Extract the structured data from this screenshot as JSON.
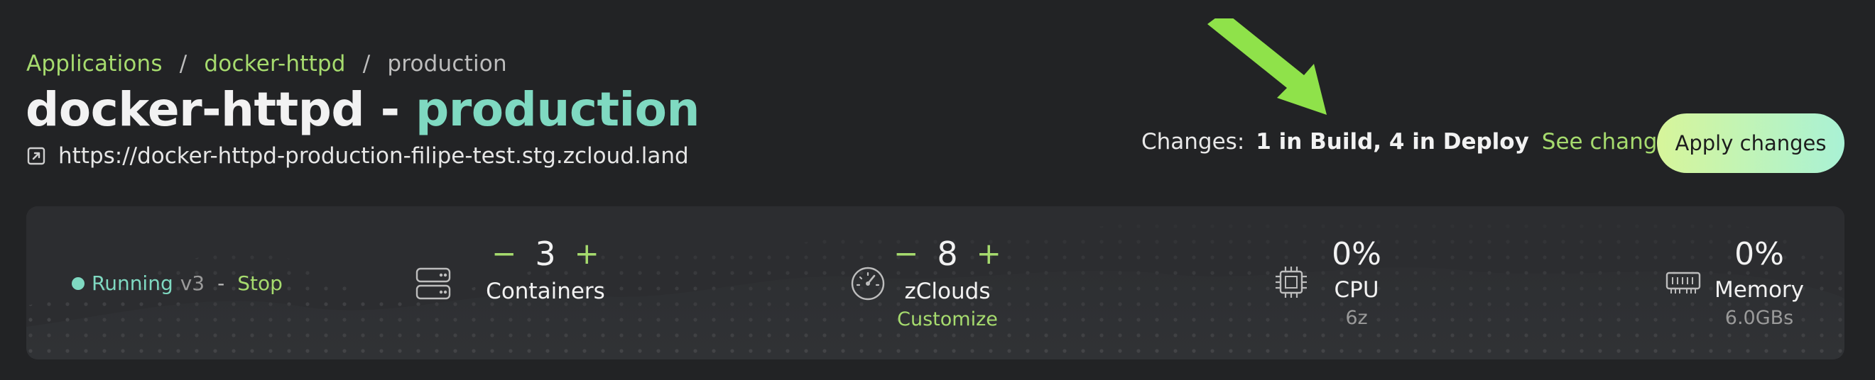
{
  "breadcrumb": {
    "items": [
      "Applications",
      "docker-httpd"
    ],
    "current": "production",
    "separator": "/"
  },
  "title": {
    "app": "docker-httpd",
    "dash": "-",
    "environment": "production"
  },
  "url": {
    "text": "https://docker-httpd-production-filipe-test.stg.zcloud.land",
    "icon": "external-link-icon"
  },
  "changes": {
    "label": "Changes:",
    "summary": "1 in Build, 4 in Deploy",
    "see_label": "See changes",
    "apply_label": "Apply changes"
  },
  "status": {
    "state": "Running",
    "version": "v3",
    "dash": "-",
    "action": "Stop"
  },
  "containers": {
    "count": "3",
    "minus": "−",
    "plus": "+",
    "label": "Containers",
    "icon": "server-icon"
  },
  "zclouds": {
    "count": "8",
    "minus": "−",
    "plus": "+",
    "label": "zClouds",
    "link": "Customize",
    "icon": "gauge-icon"
  },
  "cpu": {
    "percent": "0%",
    "label": "CPU",
    "sub": "6z",
    "icon": "cpu-chip-icon"
  },
  "memory": {
    "percent": "0%",
    "label": "Memory",
    "sub": "6.0GBs",
    "icon": "memory-icon"
  },
  "colors": {
    "background": "#222325",
    "panel": "#2c2d30",
    "accent_green": "#a6db6e",
    "accent_teal": "#7fd9c1",
    "arrow": "#8fe24a"
  }
}
